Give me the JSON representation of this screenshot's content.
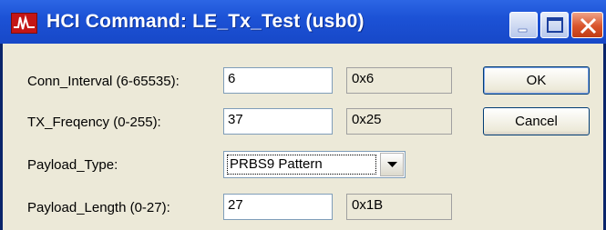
{
  "window": {
    "title": "HCI Command: LE_Tx_Test (usb0)",
    "icon": "waveform-icon"
  },
  "fields": {
    "conn_interval": {
      "label": "Conn_Interval (6-65535):",
      "value": "6",
      "hex": "0x6"
    },
    "tx_frequency": {
      "label": "TX_Freqency (0-255):",
      "value": "37",
      "hex": "0x25"
    },
    "payload_type": {
      "label": "Payload_Type:",
      "selected": "PRBS9 Pattern"
    },
    "payload_length": {
      "label": "Payload_Length (0-27):",
      "value": "27",
      "hex": "0x1B"
    }
  },
  "buttons": {
    "ok": "OK",
    "cancel": "Cancel"
  },
  "colors": {
    "titlebar": "#1c52d6",
    "client_bg": "#ece9d8",
    "close_button": "#d9542c"
  }
}
